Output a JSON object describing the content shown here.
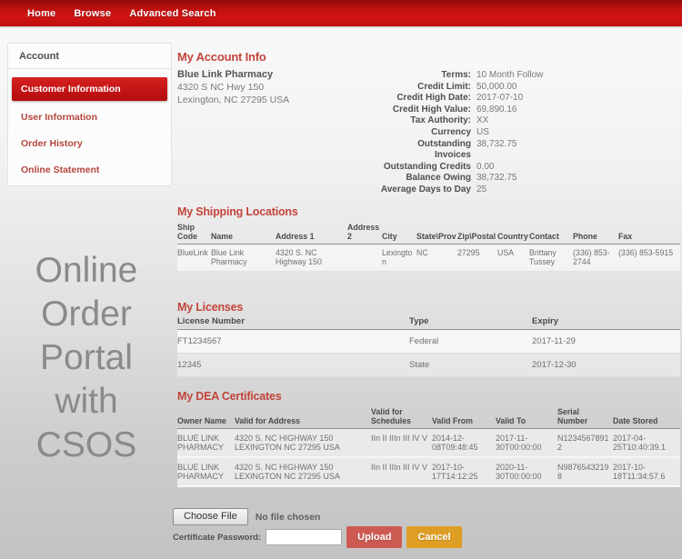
{
  "colors": {
    "nav-red": "#c81010",
    "heading-red": "#c1453b",
    "link-red": "#b5463e",
    "active-item-bg": "#c81414",
    "upload-btn": "#cd5a52",
    "cancel-btn": "#dd9e23",
    "watermark-grey": "#8a8a8a"
  },
  "nav": {
    "items": [
      {
        "label": "Home"
      },
      {
        "label": "Browse"
      },
      {
        "label": "Advanced Search"
      }
    ]
  },
  "sidebar": {
    "title": "Account",
    "items": [
      {
        "label": "Customer Information",
        "active": true
      },
      {
        "label": "User Information"
      },
      {
        "label": "Order History"
      },
      {
        "label": "Online Statement"
      }
    ]
  },
  "watermark": {
    "lines": [
      "Online",
      "Order",
      "Portal",
      "with",
      "CSOS"
    ]
  },
  "account_info": {
    "title": "My Account Info",
    "company": {
      "name": "Blue Link Pharmacy",
      "address_line1": "4320 S NC Hwy 150",
      "address_line2": "Lexington, NC 27295 USA"
    },
    "fields": [
      {
        "label": "Terms:",
        "value": "10 Month Follow"
      },
      {
        "label": "Credit Limit:",
        "value": "50,000.00"
      },
      {
        "label": "Credit High Date:",
        "value": "2017-07-10"
      },
      {
        "label": "Credit High Value:",
        "value": "69,890.16"
      },
      {
        "label": "Tax Authority:",
        "value": "XX"
      },
      {
        "label": "Currency",
        "value": "US"
      },
      {
        "label": "Outstanding Invoices",
        "value": "38,732.75"
      },
      {
        "label": "Outstanding Credits",
        "value": "0.00"
      },
      {
        "label": "Balance Owing",
        "value": "38,732.75"
      },
      {
        "label": "Average Days to Day",
        "value": "25"
      }
    ]
  },
  "shipping": {
    "title": "My Shipping Locations",
    "columns": [
      "Ship Code",
      "Name",
      "Address 1",
      "Address 2",
      "City",
      "State\\Prov",
      "Zip\\Postal",
      "Country",
      "Contact",
      "Phone",
      "Fax"
    ],
    "rows": [
      [
        "BlueLink",
        "Blue Link Pharmacy",
        "4320 S. NC Highway 150",
        "",
        "Lexington",
        "NC",
        "27295",
        "USA",
        "Brittany Tussey",
        "(336) 853-2744",
        "(336) 853-5915"
      ]
    ]
  },
  "licenses": {
    "title": "My Licenses",
    "columns": [
      "License Number",
      "Type",
      "Expiry"
    ],
    "rows": [
      [
        "FT1234567",
        "Federal",
        "2017-11-29"
      ],
      [
        "12345",
        "State",
        "2017-12-30"
      ]
    ]
  },
  "dea": {
    "title": "My DEA Certificates",
    "columns": [
      "Owner Name",
      "Valid for Address",
      "Valid for Schedules",
      "Valid From",
      "Valid To",
      "Serial Number",
      "Date Stored"
    ],
    "rows": [
      [
        "BLUE LINK PHARMACY",
        "4320 S. NC HIGHWAY 150 LEXINGTON NC 27295 USA",
        "IIn II IIIn III IV V",
        "2014-12-08T09:48:45",
        "2017-11-30T00:00:00",
        "N12345678912",
        "2017-04-25T10:40:39.1"
      ],
      [
        "BLUE LINK PHARMACY",
        "4320 S. NC HIGHWAY 150 LEXINGTON NC 27295 USA",
        "IIn II IIIn III IV V",
        "2017-10-17T14:12:25",
        "2020-11-30T00:00:00",
        "N98765432198",
        "2017-10-18T11:34:57.6"
      ]
    ]
  },
  "upload": {
    "choose_file_label": "Choose File",
    "no_file_text": "No file chosen",
    "password_label": "Certificate Password:",
    "upload_label": "Upload",
    "cancel_label": "Cancel"
  }
}
